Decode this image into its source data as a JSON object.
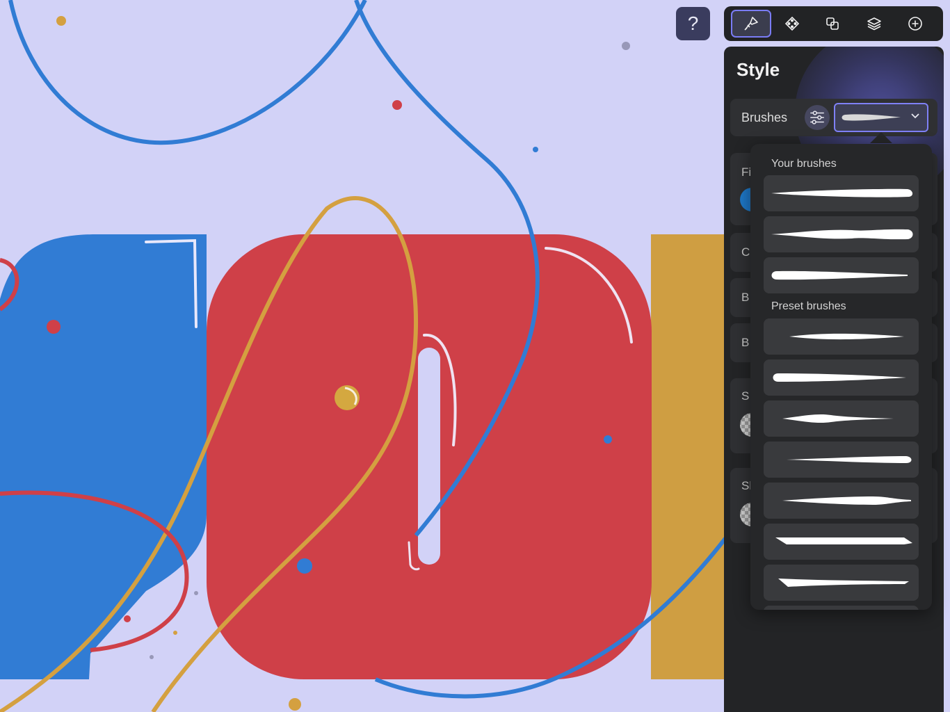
{
  "help": {
    "label": "?"
  },
  "toolbar": {
    "tools": [
      {
        "id": "style",
        "icon": "brush-icon",
        "active": true
      },
      {
        "id": "nodes",
        "icon": "node-diamond-icon",
        "active": false
      },
      {
        "id": "boolean",
        "icon": "boolean-squares-icon",
        "active": false
      },
      {
        "id": "layers",
        "icon": "layers-icon",
        "active": false
      },
      {
        "id": "add",
        "icon": "plus-circle-icon",
        "active": false
      }
    ]
  },
  "panel": {
    "title": "Style",
    "brushes_label": "Brushes",
    "hidden_sections": [
      "Fi",
      "C",
      "B",
      "B",
      "S",
      "Sl"
    ]
  },
  "popup": {
    "your_brushes_label": "Your brushes",
    "preset_brushes_label": "Preset brushes",
    "your_brushes_count": 3,
    "preset_brushes_count": 7
  },
  "colors": {
    "accent": "#7f81f6",
    "canvas_bg": "#d2d2f7",
    "blue": "#317cd4",
    "red": "#d04048",
    "gold": "#d4a040",
    "panel_bg": "#232426"
  }
}
